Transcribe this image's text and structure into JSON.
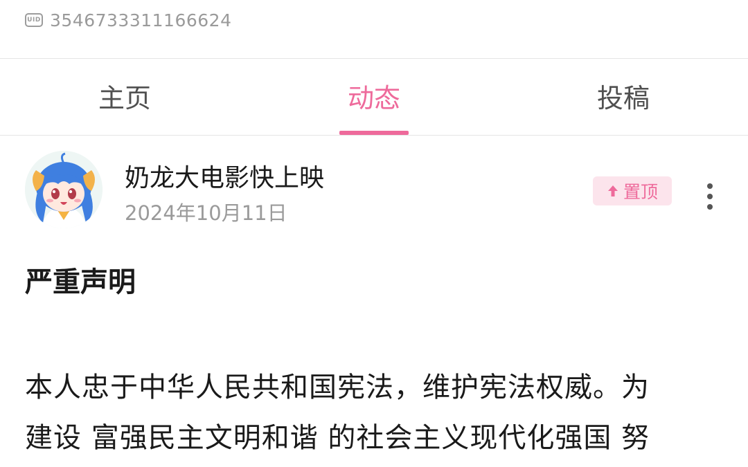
{
  "profile": {
    "uid_badge": "UID",
    "uid": "3546733311166624"
  },
  "tabs": [
    {
      "label": "主页",
      "active": false
    },
    {
      "label": "动态",
      "active": true
    },
    {
      "label": "投稿",
      "active": false
    }
  ],
  "post": {
    "author": "奶龙大电影快上映",
    "date": "2024年10月11日",
    "pin_label": "置顶",
    "title": "严重声明",
    "body_lines": [
      "本人忠于中华人民共和国宪法，维护宪法权威。为",
      "建设 富强民主文明和谐 的社会主义现代化强国 努",
      ""
    ]
  },
  "colors": {
    "accent": "#ee6a9b",
    "pin_bg": "#fce4ec",
    "text_primary": "#1a1a1a",
    "text_secondary": "#9a9a9a"
  },
  "icons": {
    "uid": "uid-badge-icon",
    "pin": "arrow-up-icon",
    "more": "more-vertical-icon",
    "avatar": "avatar-image"
  }
}
